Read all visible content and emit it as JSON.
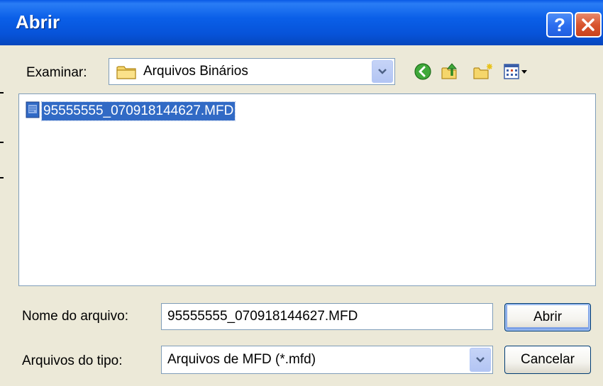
{
  "window": {
    "title": "Abrir",
    "help_button": "?",
    "close_button": "close"
  },
  "look_in": {
    "label": "Examinar:",
    "value": "Arquivos Binários",
    "icons": [
      "folder-icon",
      "chevron-down-icon",
      "back-icon",
      "up-folder-icon",
      "new-folder-icon",
      "view-menu-icon"
    ]
  },
  "file_list": {
    "items": [
      {
        "name": "95555555_070918144627.MFD",
        "icon": "file-icon",
        "selected": true
      }
    ]
  },
  "filename": {
    "label": "Nome do arquivo:",
    "value": "95555555_070918144627.MFD"
  },
  "filetype": {
    "label": "Arquivos do tipo:",
    "value": "Arquivos de MFD (*.mfd)"
  },
  "buttons": {
    "open": "Abrir",
    "cancel": "Cancelar"
  },
  "colors": {
    "titlebar": "#0a5fe8",
    "selection": "#316ac5",
    "dialog_bg": "#ece9d8",
    "close_button": "#d9552f"
  }
}
